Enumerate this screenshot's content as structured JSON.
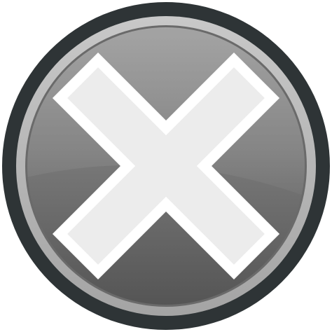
{
  "icon": {
    "name": "close-icon",
    "label": "",
    "colors": {
      "outer_ring": "#2e3436",
      "bevel": "#bcbcbc",
      "face_top": "#8c8c8c",
      "face_bottom": "#555555",
      "cross_outline": "#ffffff",
      "cross_fill": "#ececec"
    }
  }
}
